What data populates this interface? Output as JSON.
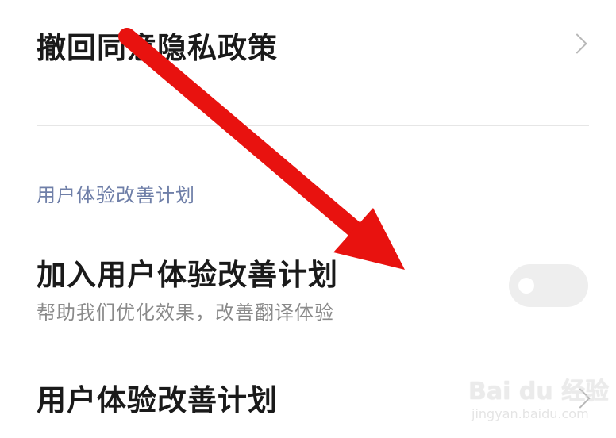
{
  "rows": {
    "withdraw_privacy": {
      "title": "撤回同意隐私政策"
    },
    "section_header": "用户体验改善计划",
    "join_program": {
      "title": "加入用户体验改善计划",
      "subtitle": "帮助我们优化效果，改善翻译体验",
      "toggle_on": false
    },
    "program_info": {
      "title": "用户体验改善计划"
    }
  },
  "icons": {
    "chevron": "chevron-right-icon",
    "annotation": "red-arrow-icon"
  },
  "colors": {
    "title_text": "#1a1a1a",
    "subtitle_text": "#8a8a8a",
    "section_header_text": "#6f7fa8",
    "toggle_off_track": "#eeeeee",
    "annotation_arrow": "#e8120f"
  },
  "watermark": {
    "logo": "Bai du 经验",
    "url": "jingyan.baidu.com"
  }
}
